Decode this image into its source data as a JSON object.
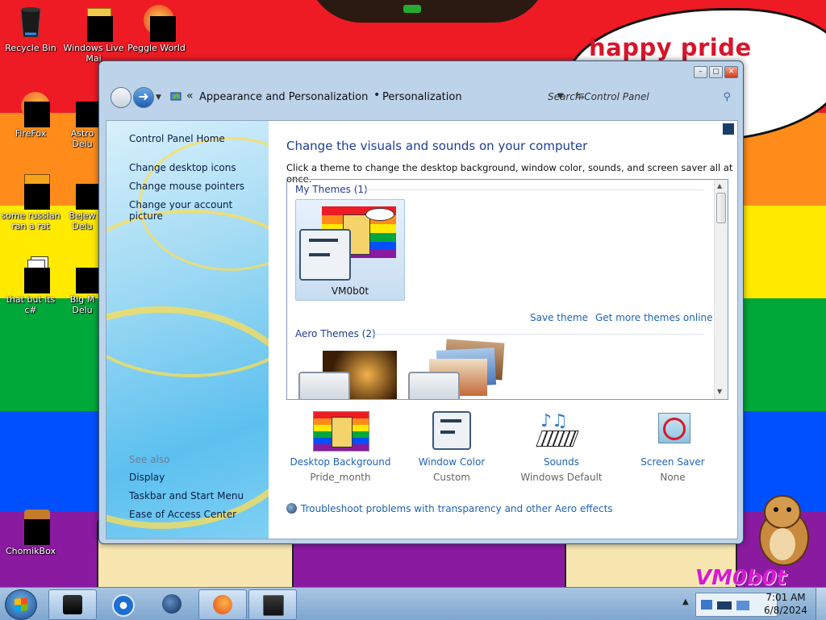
{
  "desktop": {
    "banner_text": "happy pride month",
    "logo_text": "VM0b0t",
    "icons": [
      {
        "label": "Recycle Bin",
        "icon": "recycle-bin-icon"
      },
      {
        "label": "Windows Live Mai",
        "icon": "windows-live-mail-icon"
      },
      {
        "label": "Peggle World",
        "icon": "peggle-world-icon"
      },
      {
        "label": "FireFox",
        "icon": "firefox-icon"
      },
      {
        "label": "Astro Delu",
        "icon": "astro-deluxe-icon"
      },
      {
        "label": "some russian ran a rat",
        "icon": "document-icon"
      },
      {
        "label": "Bejew Delu",
        "icon": "bejeweled-deluxe-icon"
      },
      {
        "label": "that but its c#",
        "icon": "stacked-windows-icon"
      },
      {
        "label": "Big M Delu",
        "icon": "big-money-deluxe-icon"
      },
      {
        "label": "ChomikBox",
        "icon": "chomikbox-icon"
      }
    ]
  },
  "window": {
    "controls": {
      "minimize": "–",
      "maximize": "▢",
      "close": "✕"
    },
    "nav": {
      "breadcrumbs": [
        "Appearance and Personalization",
        "Personalization"
      ],
      "overflow": "«",
      "separator": "•",
      "search_placeholder": "Search Control Panel"
    },
    "sidebar": {
      "links": [
        "Control Panel Home",
        "Change desktop icons",
        "Change mouse pointers",
        "Change your account picture"
      ],
      "see_also_title": "See also",
      "see_also": [
        "Display",
        "Taskbar and Start Menu",
        "Ease of Access Center"
      ]
    },
    "main": {
      "heading": "Change the visuals and sounds on your computer",
      "subtitle": "Click a theme to change the desktop background, window color, sounds, and screen saver all at once.",
      "my_themes_title": "My Themes (1)",
      "my_theme_name": "VM0b0t",
      "save_theme": "Save theme",
      "get_more_themes": "Get more themes online",
      "aero_themes_title": "Aero Themes (2)",
      "settings": [
        {
          "label": "Desktop Background",
          "value": "Pride_month",
          "icon": "desktop-background-icon"
        },
        {
          "label": "Window Color",
          "value": "Custom",
          "icon": "window-color-icon"
        },
        {
          "label": "Sounds",
          "value": "Windows Default",
          "icon": "sounds-icon"
        },
        {
          "label": "Screen Saver",
          "value": "None",
          "icon": "screen-saver-icon"
        }
      ],
      "troubleshoot": "Troubleshoot problems with transparency and other Aero effects"
    }
  },
  "taskbar": {
    "pinned": [
      "media-center-icon",
      "windows-media-player-icon",
      "internet-explorer-icon",
      "firefox-icon",
      "control-panel-icon"
    ],
    "clock_time": "7:01 AM",
    "clock_date": "6/8/2024"
  },
  "colors": {
    "link": "#1e63b3",
    "heading": "#1e3d92",
    "window_frame": "#bcd3ea"
  }
}
